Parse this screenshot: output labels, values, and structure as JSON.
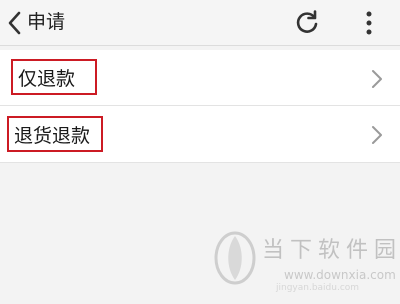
{
  "header": {
    "title": "申请",
    "back_icon": "chevron-left-icon",
    "refresh_icon": "refresh-icon",
    "more_icon": "more-vertical-icon"
  },
  "options": [
    {
      "label": "仅退款",
      "icon": "chevron-right-icon"
    },
    {
      "label": "退货退款",
      "icon": "chevron-right-icon"
    }
  ],
  "highlight_color": "#cc1b24",
  "watermark": {
    "text": "当下软件园",
    "url": "www.downxia.com",
    "url2": "jingyan.baidu.com"
  }
}
